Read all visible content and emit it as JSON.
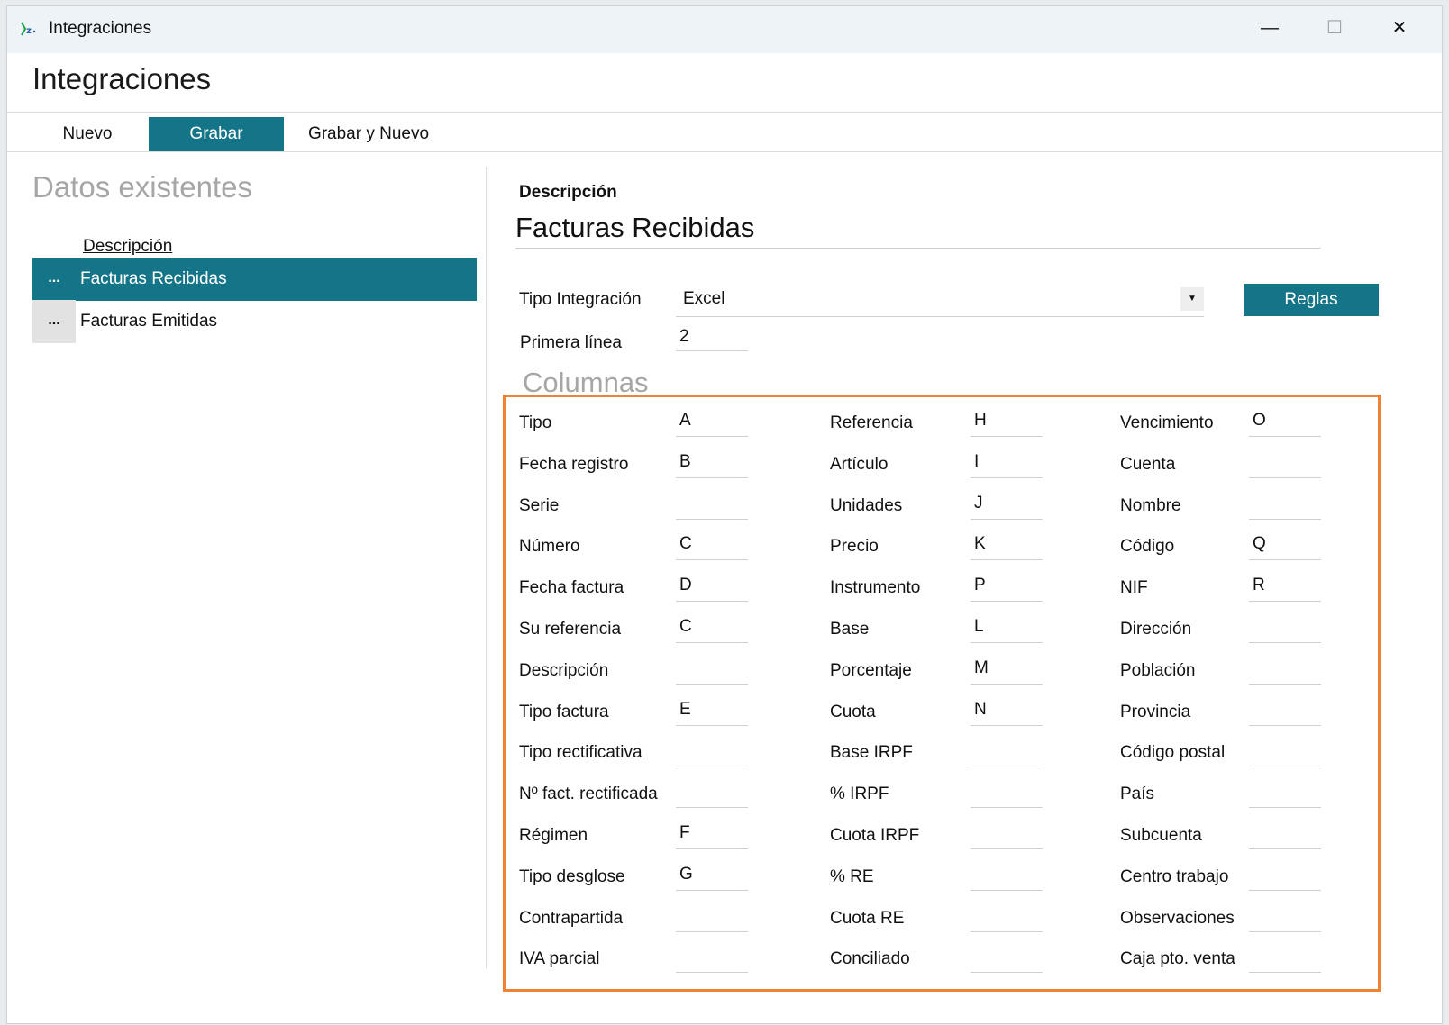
{
  "window": {
    "title": "Integraciones",
    "controls": {
      "minimize": "—",
      "maximize": "☐",
      "close": "✕"
    }
  },
  "heading": "Integraciones",
  "toolbar": {
    "nuevo": "Nuevo",
    "grabar": "Grabar",
    "grabar_nuevo": "Grabar y Nuevo"
  },
  "left": {
    "section_title": "Datos existentes",
    "column_header": "Descripción",
    "items": [
      {
        "ellipsis": "...",
        "label": "Facturas Recibidas",
        "selected": true
      },
      {
        "ellipsis": "...",
        "label": "Facturas Emitidas",
        "selected": false
      }
    ]
  },
  "form": {
    "descripcion_label": "Descripción",
    "descripcion_value": "Facturas Recibidas",
    "tipo_label": "Tipo Integración",
    "tipo_value": "Excel",
    "reglas_label": "Reglas",
    "primera_label": "Primera línea",
    "primera_value": "2",
    "columnas_title": "Columnas"
  },
  "columns": [
    [
      {
        "label": "Tipo",
        "value": "A"
      },
      {
        "label": "Fecha registro",
        "value": "B"
      },
      {
        "label": "Serie",
        "value": ""
      },
      {
        "label": "Número",
        "value": "C"
      },
      {
        "label": "Fecha factura",
        "value": "D"
      },
      {
        "label": "Su referencia",
        "value": "C"
      },
      {
        "label": "Descripción",
        "value": ""
      },
      {
        "label": "Tipo factura",
        "value": "E"
      },
      {
        "label": "Tipo rectificativa",
        "value": ""
      },
      {
        "label": "Nº fact. rectificada",
        "value": ""
      },
      {
        "label": "Régimen",
        "value": "F"
      },
      {
        "label": "Tipo desglose",
        "value": "G"
      },
      {
        "label": "Contrapartida",
        "value": ""
      },
      {
        "label": "IVA parcial",
        "value": ""
      }
    ],
    [
      {
        "label": "Referencia",
        "value": "H"
      },
      {
        "label": "Artículo",
        "value": "I"
      },
      {
        "label": "Unidades",
        "value": "J"
      },
      {
        "label": "Precio",
        "value": "K"
      },
      {
        "label": "Instrumento",
        "value": "P"
      },
      {
        "label": "Base",
        "value": "L"
      },
      {
        "label": "Porcentaje",
        "value": "M"
      },
      {
        "label": "Cuota",
        "value": "N"
      },
      {
        "label": "Base IRPF",
        "value": ""
      },
      {
        "label": "% IRPF",
        "value": ""
      },
      {
        "label": "Cuota IRPF",
        "value": ""
      },
      {
        "label": "% RE",
        "value": ""
      },
      {
        "label": "Cuota RE",
        "value": ""
      },
      {
        "label": "Conciliado",
        "value": ""
      }
    ],
    [
      {
        "label": "Vencimiento",
        "value": "O"
      },
      {
        "label": "Cuenta",
        "value": ""
      },
      {
        "label": "Nombre",
        "value": ""
      },
      {
        "label": "Código",
        "value": "Q"
      },
      {
        "label": "NIF",
        "value": "R"
      },
      {
        "label": "Dirección",
        "value": ""
      },
      {
        "label": "Población",
        "value": ""
      },
      {
        "label": "Provincia",
        "value": ""
      },
      {
        "label": "Código postal",
        "value": ""
      },
      {
        "label": "País",
        "value": ""
      },
      {
        "label": "Subcuenta",
        "value": ""
      },
      {
        "label": "Centro trabajo",
        "value": ""
      },
      {
        "label": "Observaciones",
        "value": ""
      },
      {
        "label": "Caja pto. venta",
        "value": ""
      }
    ]
  ],
  "colors": {
    "accent": "#157588",
    "highlight_border": "#ef8233"
  }
}
